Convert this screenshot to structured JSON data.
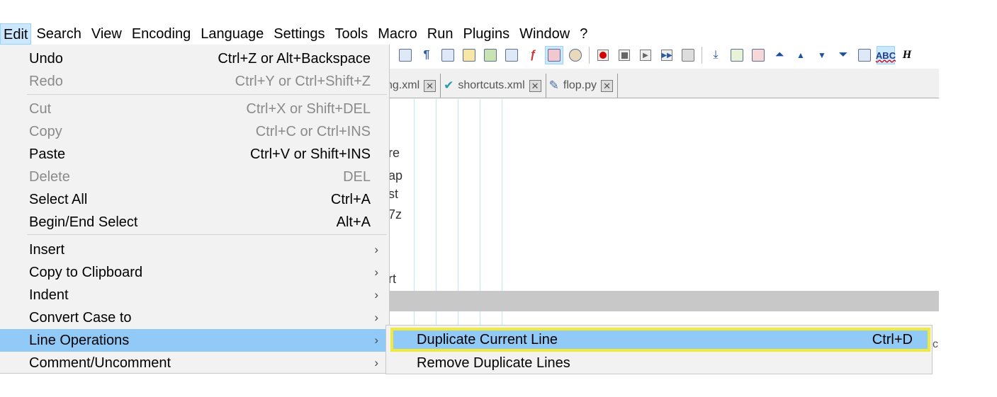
{
  "menubar": {
    "items": [
      "Edit",
      "Search",
      "View",
      "Encoding",
      "Language",
      "Settings",
      "Tools",
      "Macro",
      "Run",
      "Plugins",
      "Window",
      "?"
    ]
  },
  "tabs": [
    {
      "label": "ng.xml",
      "icon": "none"
    },
    {
      "label": "shortcuts.xml",
      "icon": "checkmark-icon"
    },
    {
      "label": "flop.py",
      "icon": "pencil-icon"
    }
  ],
  "toolbar": {
    "spellcheck_label": "ABC",
    "h_label": "H"
  },
  "editor": {
    "fragments": [
      "re",
      "ap",
      "st",
      "7z",
      "rt"
    ]
  },
  "edit_menu": {
    "items": [
      {
        "label": "Undo",
        "shortcut": "Ctrl+Z or Alt+Backspace",
        "disabled": false
      },
      {
        "label": "Redo",
        "shortcut": "Ctrl+Y or Ctrl+Shift+Z",
        "disabled": true
      },
      {
        "label": "Cut",
        "shortcut": "Ctrl+X or Shift+DEL",
        "disabled": true
      },
      {
        "label": "Copy",
        "shortcut": "Ctrl+C or Ctrl+INS",
        "disabled": true
      },
      {
        "label": "Paste",
        "shortcut": "Ctrl+V or Shift+INS",
        "disabled": false
      },
      {
        "label": "Delete",
        "shortcut": "DEL",
        "disabled": true
      },
      {
        "label": "Select All",
        "shortcut": "Ctrl+A",
        "disabled": false
      },
      {
        "label": "Begin/End Select",
        "shortcut": "Alt+A",
        "disabled": false
      },
      {
        "label": "Insert",
        "submenu": true
      },
      {
        "label": "Copy to Clipboard",
        "submenu": true
      },
      {
        "label": "Indent",
        "submenu": true
      },
      {
        "label": "Convert Case to",
        "submenu": true
      },
      {
        "label": "Line Operations",
        "submenu": true,
        "highlighted": true
      },
      {
        "label": "Comment/Uncomment",
        "submenu": true
      }
    ],
    "arrow": "›"
  },
  "line_operations_menu": {
    "items": [
      {
        "label": "Duplicate Current Line",
        "shortcut": "Ctrl+D",
        "highlighted": true
      },
      {
        "label": "Remove Duplicate Lines",
        "shortcut": ""
      }
    ]
  },
  "colors": {
    "menu_bg": "#f2f2f2",
    "highlight": "#91c9f7",
    "focus_outline": "#f0eb3a",
    "disabled_text": "#8a8a8a"
  }
}
